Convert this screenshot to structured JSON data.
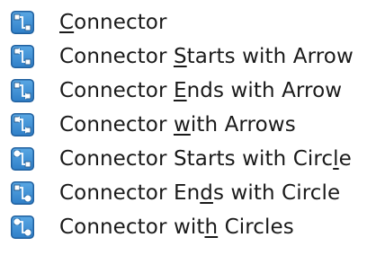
{
  "menu": {
    "items": [
      {
        "pre": "",
        "mn": "C",
        "post": "onnector",
        "icon": "connector-icon",
        "start": "none",
        "end": "none"
      },
      {
        "pre": "Connector ",
        "mn": "S",
        "post": "tarts with Arrow",
        "icon": "connector-starts-with-arrow-icon",
        "start": "arrow",
        "end": "none"
      },
      {
        "pre": "Connector ",
        "mn": "E",
        "post": "nds with Arrow",
        "icon": "connector-ends-with-arrow-icon",
        "start": "none",
        "end": "arrow"
      },
      {
        "pre": "Connector ",
        "mn": "w",
        "post": "ith Arrows",
        "icon": "connector-with-arrows-icon",
        "start": "arrow",
        "end": "arrow"
      },
      {
        "pre": "Connector Starts with Circ",
        "mn": "l",
        "post": "e",
        "icon": "connector-starts-with-circle-icon",
        "start": "circle",
        "end": "none"
      },
      {
        "pre": "Connector En",
        "mn": "d",
        "post": "s with Circle",
        "icon": "connector-ends-with-circle-icon",
        "start": "none",
        "end": "circle"
      },
      {
        "pre": "Connector wit",
        "mn": "h",
        "post": " Circles",
        "icon": "connector-with-circles-icon",
        "start": "circle",
        "end": "circle"
      }
    ],
    "colors": {
      "icon_bg_top": "#5aa8e4",
      "icon_bg_bottom": "#2f7fc8",
      "icon_border": "#1f5f9e",
      "icon_box": "#ffffff",
      "icon_line": "#ffffff",
      "icon_box_stroke": "#2a5f92"
    }
  }
}
